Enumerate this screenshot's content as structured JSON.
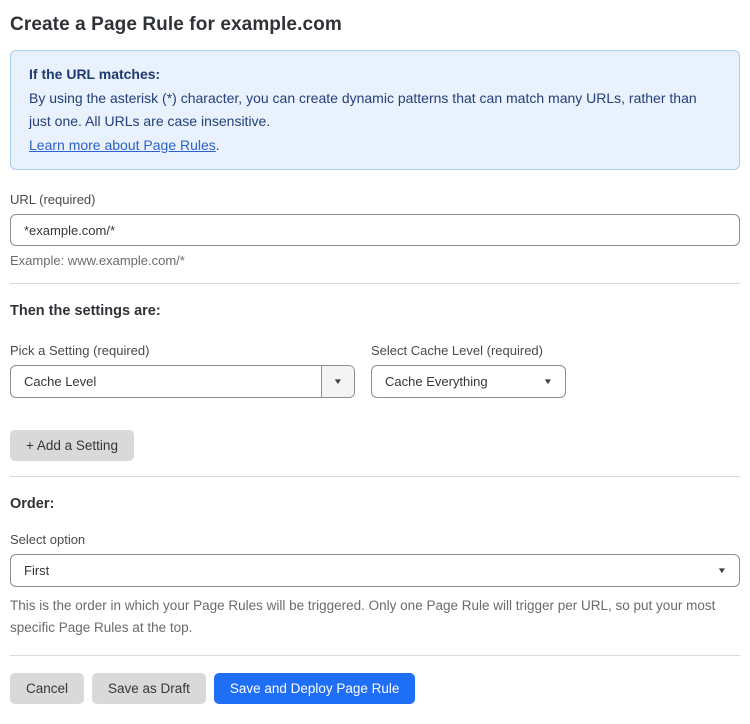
{
  "page": {
    "title": "Create a Page Rule for example.com"
  },
  "info_box": {
    "heading": "If the URL matches:",
    "body": "By using the asterisk (*) character, you can create dynamic patterns that can match many URLs, rather than just one. All URLs are case insensitive.",
    "link_label": "Learn more about Page Rules",
    "link_suffix": "."
  },
  "url_field": {
    "label": "URL (required)",
    "value": "*example.com/*",
    "helper": "Example: www.example.com/*"
  },
  "settings_section": {
    "heading": "Then the settings are:",
    "setting_select": {
      "label": "Pick a Setting (required)",
      "value": "Cache Level"
    },
    "cache_level_select": {
      "label": "Select Cache Level (required)",
      "value": "Cache Everything"
    },
    "add_setting_label": "+ Add a Setting"
  },
  "order_section": {
    "heading": "Order:",
    "select_label": "Select option",
    "select_value": "First",
    "helper": "This is the order in which your Page Rules will be triggered. Only one Page Rule will trigger per URL, so put your most specific Page Rules at the top."
  },
  "footer": {
    "cancel_label": "Cancel",
    "save_draft_label": "Save as Draft",
    "save_deploy_label": "Save and Deploy Page Rule"
  },
  "icons": {
    "dropdown_arrow": "▼"
  },
  "colors": {
    "primary_blue": "#1f6ef6",
    "info_bg": "#e8f1fc",
    "info_border": "#abcdf0",
    "info_text": "#24407a",
    "link_blue": "#2d62c6",
    "button_gray": "#d9d9d9",
    "divider_gray": "#d9d9d9"
  }
}
